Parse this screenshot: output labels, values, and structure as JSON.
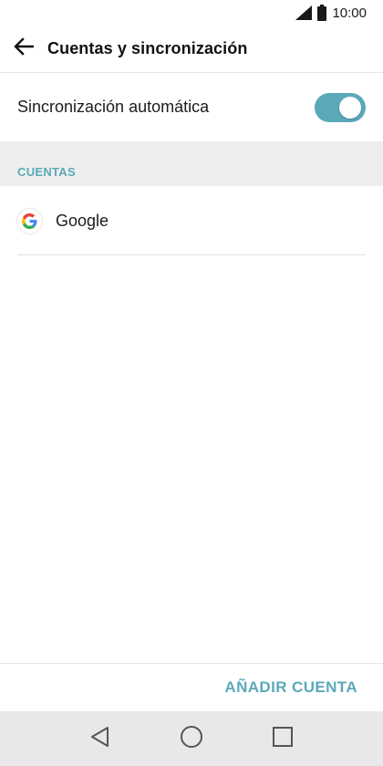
{
  "status_bar": {
    "time": "10:00",
    "icons": [
      "signal-icon",
      "battery-icon"
    ]
  },
  "header": {
    "title": "Cuentas y sincronización",
    "back_icon": "arrow-back-icon"
  },
  "sync": {
    "label": "Sincronización automática",
    "enabled": true
  },
  "accounts_section": {
    "title": "CUENTAS",
    "items": [
      {
        "name": "Google",
        "icon": "google-icon"
      }
    ]
  },
  "footer": {
    "add_account_label": "AÑADIR CUENTA"
  },
  "nav": {
    "buttons": [
      "back-triangle-icon",
      "home-circle-icon",
      "recents-square-icon"
    ]
  },
  "colors": {
    "accent": "#5aa9b9",
    "toggle_on": "#5aa9b9",
    "section_bg": "#eeeeee",
    "nav_bg": "#e8e8eb"
  }
}
